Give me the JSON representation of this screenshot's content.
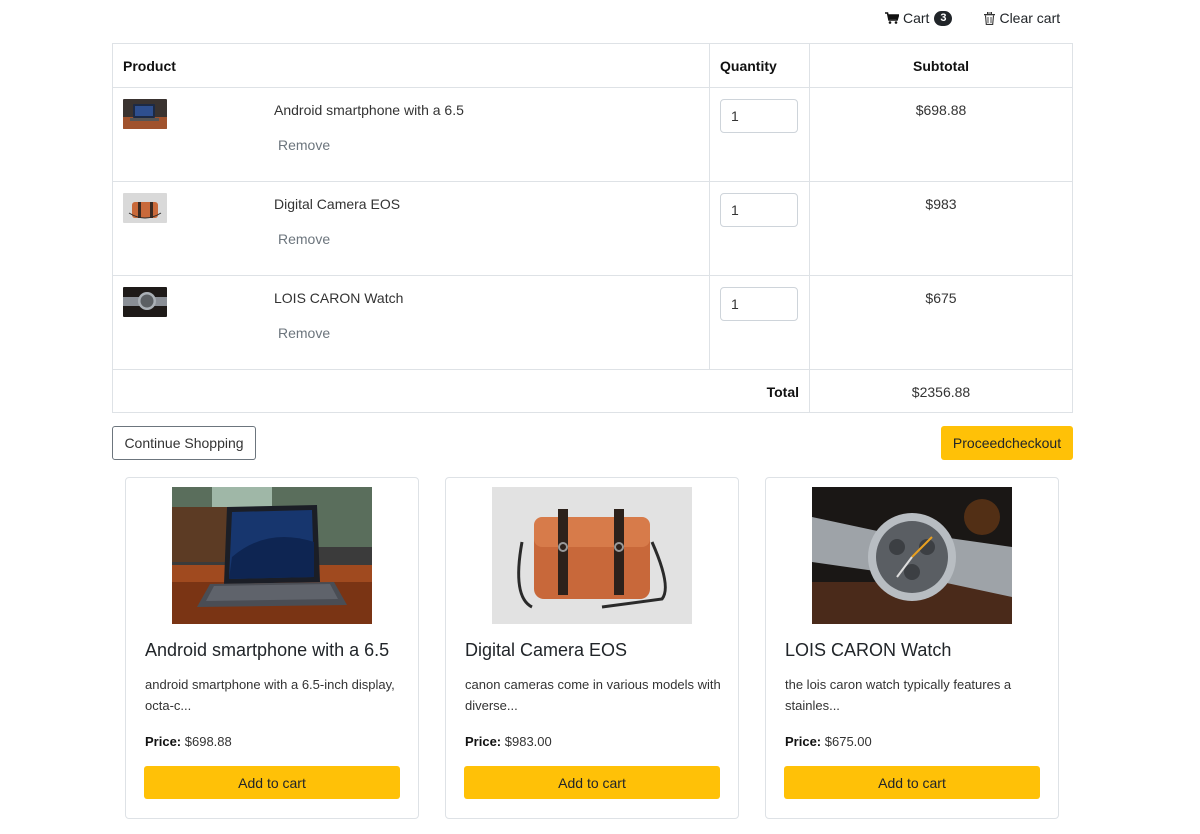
{
  "nav": {
    "cart_label": "Cart",
    "cart_count": "3",
    "clear_label": "Clear cart",
    "icons": [
      "shopping-cart-icon",
      "trash-icon"
    ]
  },
  "cart": {
    "headers": {
      "product": "Product",
      "quantity": "Quantity",
      "subtotal": "Subtotal"
    },
    "remove_label": "Remove",
    "items": [
      {
        "name": "Android smartphone with a 6.5",
        "quantity": "1",
        "subtotal": "$698.88",
        "image": "laptop-photo"
      },
      {
        "name": "Digital Camera EOS",
        "quantity": "1",
        "subtotal": "$983",
        "image": "leather-bag-photo"
      },
      {
        "name": "LOIS CARON Watch",
        "quantity": "1",
        "subtotal": "$675",
        "image": "wristwatch-photo"
      }
    ],
    "total_label": "Total",
    "total_value": "$2356.88"
  },
  "actions": {
    "continue_label": "Continue Shopping",
    "checkout_label": "Proceedcheckout"
  },
  "products": [
    {
      "title": "Android smartphone with a 6.5",
      "desc": "android smartphone with a 6.5-inch display, octa-c...",
      "price_label": "Price:",
      "price": "$698.88",
      "button": "Add to cart",
      "image": "laptop-photo"
    },
    {
      "title": "Digital Camera EOS",
      "desc": "canon cameras come in various models with diverse...",
      "price_label": "Price:",
      "price": "$983.00",
      "button": "Add to cart",
      "image": "leather-bag-photo"
    },
    {
      "title": "LOIS CARON Watch",
      "desc": "the lois caron watch typically features a stainles...",
      "price_label": "Price:",
      "price": "$675.00",
      "button": "Add to cart",
      "image": "wristwatch-photo"
    }
  ],
  "colors": {
    "accent": "#ffc107",
    "border": "#dee2e6",
    "muted": "#6c757d"
  }
}
